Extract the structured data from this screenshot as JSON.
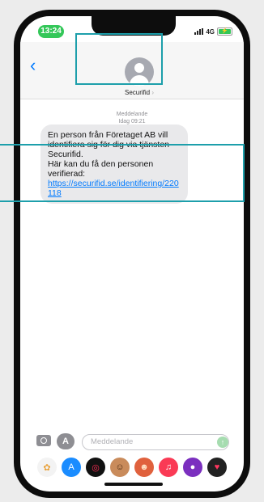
{
  "status_bar": {
    "time": "13:24",
    "network": "4G"
  },
  "header": {
    "back_icon": "chevron-left-icon",
    "contact_name": "Securifid",
    "chevron": "›"
  },
  "thread": {
    "meta_label": "Meddelande",
    "meta_time": "Idag 09:21",
    "message": {
      "line1": "En person från Företaget AB vill identifiera sig för dig via tjänsten Securifid.",
      "line2": "Här kan du få den personen verifierad:",
      "link": "https://securifid.se/identifiering/220118"
    }
  },
  "compose": {
    "placeholder": "Meddelande",
    "send_icon": "arrow-up-icon"
  },
  "dock_apps": [
    {
      "name": "photos-app-icon",
      "glyph": "✿",
      "bg": "#f3f3f3",
      "fg": "#e8a13a"
    },
    {
      "name": "appstore-app-icon",
      "glyph": "A",
      "bg": "#1a8cff",
      "fg": "#ffffff"
    },
    {
      "name": "activity-app-icon",
      "glyph": "◎",
      "bg": "#111111",
      "fg": "#ff2d55"
    },
    {
      "name": "memoji-app-icon",
      "glyph": "☺",
      "bg": "#c98b5b",
      "fg": "#4a2b14"
    },
    {
      "name": "animoji-app-icon",
      "glyph": "☻",
      "bg": "#e0613d",
      "fg": "#ffe0c2"
    },
    {
      "name": "music-app-icon",
      "glyph": "♫",
      "bg": "#fa3a55",
      "fg": "#ffffff"
    },
    {
      "name": "record-app-icon",
      "glyph": "●",
      "bg": "#7b2fbf",
      "fg": "#ffffff"
    },
    {
      "name": "heart-app-icon",
      "glyph": "♥",
      "bg": "#222222",
      "fg": "#ff375f"
    }
  ],
  "colors": {
    "accent": "#007aff",
    "highlight": "#1d9fab",
    "time_pill": "#34c759"
  }
}
